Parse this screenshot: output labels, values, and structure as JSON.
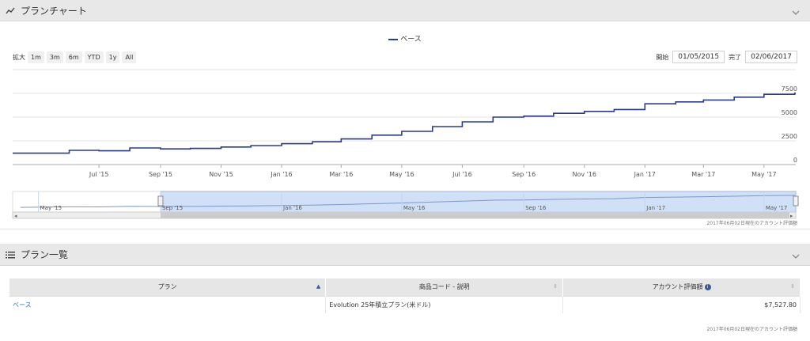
{
  "chart_panel": {
    "title": "プランチャート",
    "icon": "chart-line-icon",
    "collapse_icon": "chevron-down-icon"
  },
  "list_panel": {
    "title": "プラン一覧",
    "icon": "list-icon",
    "collapse_icon": "chevron-down-icon"
  },
  "toolbar": {
    "zoom_label": "拡大",
    "zoom_buttons": [
      "1m",
      "3m",
      "6m",
      "YTD",
      "1y",
      "All"
    ],
    "start_label": "開始",
    "start_value": "01/05/2015",
    "end_label": "完了",
    "end_value": "02/06/2017"
  },
  "chart_note": "2017年06月02日現在のアカウント評価額",
  "table_note": "2017年06月02日現在のアカウント評価額",
  "colors": {
    "line": "#2b3a8f",
    "navigator_fill": "#cfe0f7",
    "link": "#3a6fb5"
  },
  "chart_data": {
    "type": "line",
    "legend_position": "top-center",
    "series": [
      {
        "name": "ベース",
        "x": [
          "2015-05-01",
          "2015-06-01",
          "2015-07-01",
          "2015-08-01",
          "2015-09-01",
          "2015-10-01",
          "2015-11-01",
          "2015-12-01",
          "2016-01-01",
          "2016-02-01",
          "2016-03-01",
          "2016-04-01",
          "2016-05-01",
          "2016-06-01",
          "2016-07-01",
          "2016-08-01",
          "2016-09-01",
          "2016-10-01",
          "2016-11-01",
          "2016-12-01",
          "2017-01-01",
          "2017-02-01",
          "2017-03-01",
          "2017-04-01",
          "2017-05-01",
          "2017-06-01"
        ],
        "y": [
          1200,
          1500,
          1450,
          1750,
          1650,
          1700,
          1850,
          2000,
          2200,
          2400,
          2700,
          3100,
          3500,
          4000,
          4500,
          5000,
          5100,
          5400,
          5600,
          5800,
          6400,
          6600,
          6800,
          7100,
          7400,
          7528
        ]
      }
    ],
    "x_ticks": [
      "Jul '15",
      "Sep '15",
      "Nov '15",
      "Jan '16",
      "Mar '16",
      "May '16",
      "Jul '16",
      "Sep '16",
      "Nov '16",
      "Jan '17",
      "Mar '17",
      "May '17"
    ],
    "y_ticks": [
      "0",
      "2500",
      "5000",
      "7500"
    ],
    "ylim": [
      0,
      7500
    ],
    "grid": true,
    "navigator_ticks": [
      "May '15",
      "Sep '15",
      "Jan '16",
      "May '16",
      "Sep '16",
      "Jan '17",
      "May '17"
    ]
  },
  "table": {
    "headers": [
      "プラン",
      "商品コード - 説明",
      "アカウント評価額"
    ],
    "rows": [
      [
        "ベース",
        "Evolution 25年積立プラン(米ドル)",
        "$7,527.80"
      ]
    ]
  }
}
